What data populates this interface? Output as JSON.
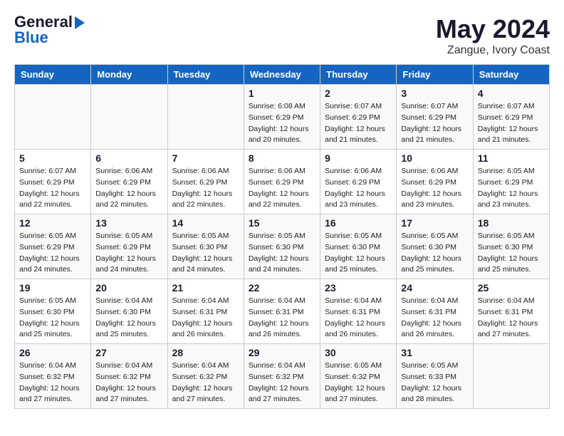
{
  "header": {
    "logo_line1": "General",
    "logo_line2": "Blue",
    "month_year": "May 2024",
    "location": "Zangue, Ivory Coast"
  },
  "weekdays": [
    "Sunday",
    "Monday",
    "Tuesday",
    "Wednesday",
    "Thursday",
    "Friday",
    "Saturday"
  ],
  "weeks": [
    [
      {
        "day": "",
        "info": ""
      },
      {
        "day": "",
        "info": ""
      },
      {
        "day": "",
        "info": ""
      },
      {
        "day": "1",
        "info": "Sunrise: 6:08 AM\nSunset: 6:29 PM\nDaylight: 12 hours\nand 20 minutes."
      },
      {
        "day": "2",
        "info": "Sunrise: 6:07 AM\nSunset: 6:29 PM\nDaylight: 12 hours\nand 21 minutes."
      },
      {
        "day": "3",
        "info": "Sunrise: 6:07 AM\nSunset: 6:29 PM\nDaylight: 12 hours\nand 21 minutes."
      },
      {
        "day": "4",
        "info": "Sunrise: 6:07 AM\nSunset: 6:29 PM\nDaylight: 12 hours\nand 21 minutes."
      }
    ],
    [
      {
        "day": "5",
        "info": "Sunrise: 6:07 AM\nSunset: 6:29 PM\nDaylight: 12 hours\nand 22 minutes."
      },
      {
        "day": "6",
        "info": "Sunrise: 6:06 AM\nSunset: 6:29 PM\nDaylight: 12 hours\nand 22 minutes."
      },
      {
        "day": "7",
        "info": "Sunrise: 6:06 AM\nSunset: 6:29 PM\nDaylight: 12 hours\nand 22 minutes."
      },
      {
        "day": "8",
        "info": "Sunrise: 6:06 AM\nSunset: 6:29 PM\nDaylight: 12 hours\nand 22 minutes."
      },
      {
        "day": "9",
        "info": "Sunrise: 6:06 AM\nSunset: 6:29 PM\nDaylight: 12 hours\nand 23 minutes."
      },
      {
        "day": "10",
        "info": "Sunrise: 6:06 AM\nSunset: 6:29 PM\nDaylight: 12 hours\nand 23 minutes."
      },
      {
        "day": "11",
        "info": "Sunrise: 6:05 AM\nSunset: 6:29 PM\nDaylight: 12 hours\nand 23 minutes."
      }
    ],
    [
      {
        "day": "12",
        "info": "Sunrise: 6:05 AM\nSunset: 6:29 PM\nDaylight: 12 hours\nand 24 minutes."
      },
      {
        "day": "13",
        "info": "Sunrise: 6:05 AM\nSunset: 6:29 PM\nDaylight: 12 hours\nand 24 minutes."
      },
      {
        "day": "14",
        "info": "Sunrise: 6:05 AM\nSunset: 6:30 PM\nDaylight: 12 hours\nand 24 minutes."
      },
      {
        "day": "15",
        "info": "Sunrise: 6:05 AM\nSunset: 6:30 PM\nDaylight: 12 hours\nand 24 minutes."
      },
      {
        "day": "16",
        "info": "Sunrise: 6:05 AM\nSunset: 6:30 PM\nDaylight: 12 hours\nand 25 minutes."
      },
      {
        "day": "17",
        "info": "Sunrise: 6:05 AM\nSunset: 6:30 PM\nDaylight: 12 hours\nand 25 minutes."
      },
      {
        "day": "18",
        "info": "Sunrise: 6:05 AM\nSunset: 6:30 PM\nDaylight: 12 hours\nand 25 minutes."
      }
    ],
    [
      {
        "day": "19",
        "info": "Sunrise: 6:05 AM\nSunset: 6:30 PM\nDaylight: 12 hours\nand 25 minutes."
      },
      {
        "day": "20",
        "info": "Sunrise: 6:04 AM\nSunset: 6:30 PM\nDaylight: 12 hours\nand 25 minutes."
      },
      {
        "day": "21",
        "info": "Sunrise: 6:04 AM\nSunset: 6:31 PM\nDaylight: 12 hours\nand 26 minutes."
      },
      {
        "day": "22",
        "info": "Sunrise: 6:04 AM\nSunset: 6:31 PM\nDaylight: 12 hours\nand 26 minutes."
      },
      {
        "day": "23",
        "info": "Sunrise: 6:04 AM\nSunset: 6:31 PM\nDaylight: 12 hours\nand 26 minutes."
      },
      {
        "day": "24",
        "info": "Sunrise: 6:04 AM\nSunset: 6:31 PM\nDaylight: 12 hours\nand 26 minutes."
      },
      {
        "day": "25",
        "info": "Sunrise: 6:04 AM\nSunset: 6:31 PM\nDaylight: 12 hours\nand 27 minutes."
      }
    ],
    [
      {
        "day": "26",
        "info": "Sunrise: 6:04 AM\nSunset: 6:32 PM\nDaylight: 12 hours\nand 27 minutes."
      },
      {
        "day": "27",
        "info": "Sunrise: 6:04 AM\nSunset: 6:32 PM\nDaylight: 12 hours\nand 27 minutes."
      },
      {
        "day": "28",
        "info": "Sunrise: 6:04 AM\nSunset: 6:32 PM\nDaylight: 12 hours\nand 27 minutes."
      },
      {
        "day": "29",
        "info": "Sunrise: 6:04 AM\nSunset: 6:32 PM\nDaylight: 12 hours\nand 27 minutes."
      },
      {
        "day": "30",
        "info": "Sunrise: 6:05 AM\nSunset: 6:32 PM\nDaylight: 12 hours\nand 27 minutes."
      },
      {
        "day": "31",
        "info": "Sunrise: 6:05 AM\nSunset: 6:33 PM\nDaylight: 12 hours\nand 28 minutes."
      },
      {
        "day": "",
        "info": ""
      }
    ]
  ]
}
